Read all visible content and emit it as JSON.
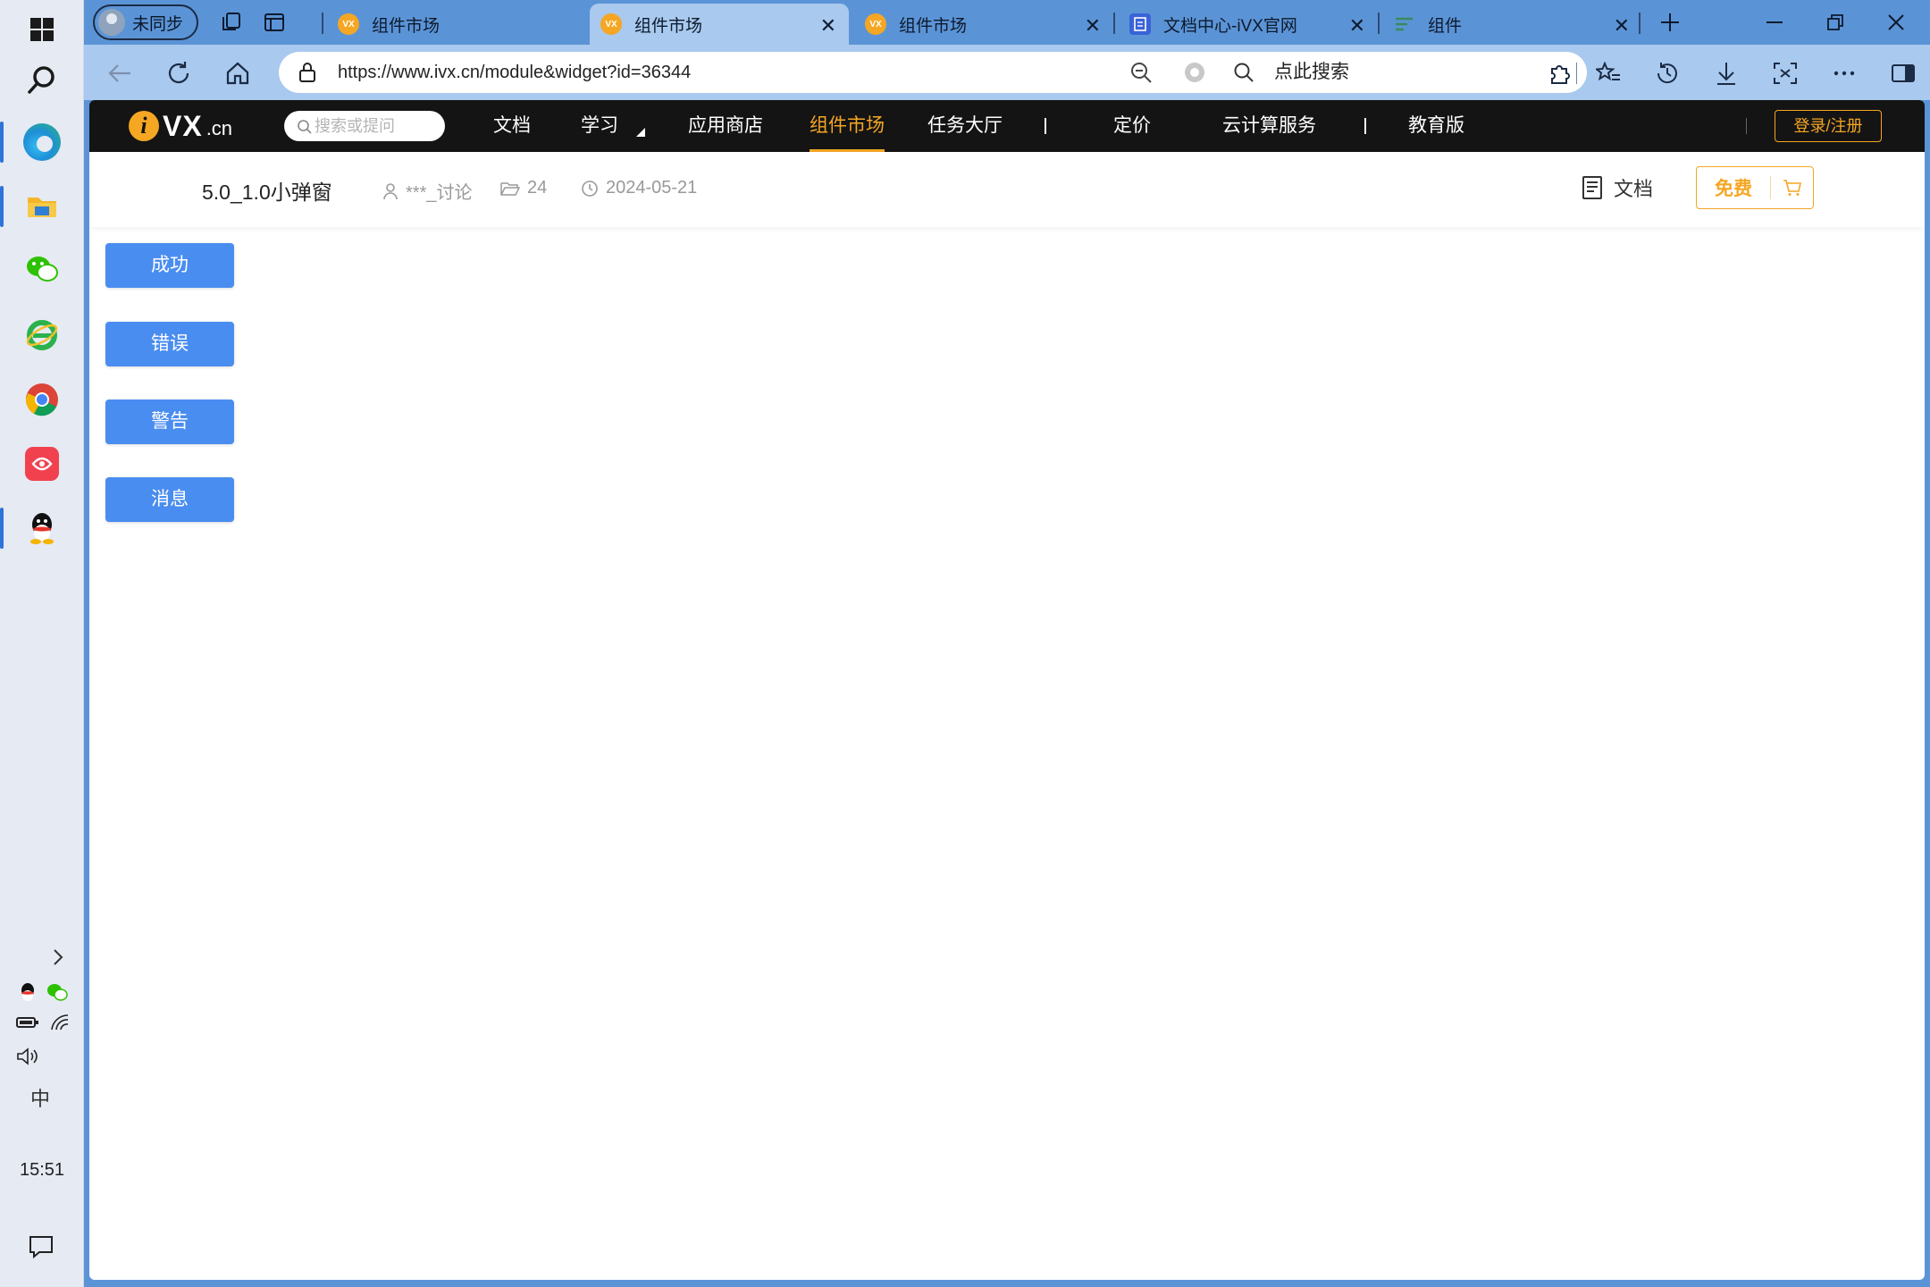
{
  "taskbar": {
    "clock": "15:51",
    "ime": "中"
  },
  "browser": {
    "profile_label": "未同步",
    "tabs": [
      {
        "title": "组件市场",
        "favicon": "VX"
      },
      {
        "title": "组件市场",
        "favicon": "VX"
      },
      {
        "title": "组件市场",
        "favicon": "VX"
      },
      {
        "title": "文档中心-iVX官网",
        "favicon": "doc"
      },
      {
        "title": "组件",
        "favicon": "list"
      }
    ],
    "url": "https://www.ivx.cn/module&widget?id=36344",
    "search_placeholder": "点此搜索"
  },
  "site": {
    "logo_vx": "VX",
    "logo_cn": ".cn",
    "search_placeholder": "搜索或提问",
    "nav": {
      "docs": "文档",
      "learn": "学习",
      "appstore": "应用商店",
      "widgets": "组件市场",
      "tasks": "任务大厅",
      "pricing": "定价",
      "cloud": "云计算服务",
      "edu": "教育版"
    },
    "login": "登录/注册"
  },
  "widget": {
    "title": "5.0_1.0小弹窗",
    "author": "***_讨论",
    "count": "24",
    "date": "2024-05-21",
    "docs_label": "文档",
    "free_label": "免费"
  },
  "demo_buttons": {
    "success": "成功",
    "error": "错误",
    "warning": "警告",
    "info": "消息"
  }
}
